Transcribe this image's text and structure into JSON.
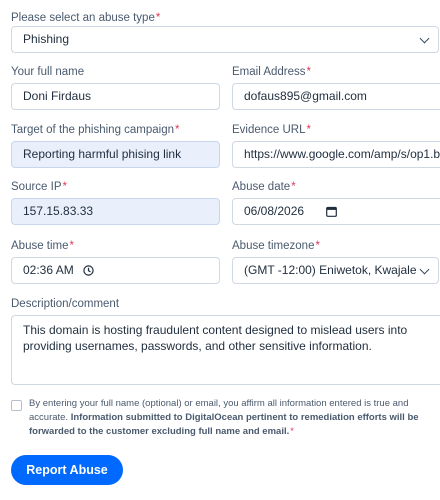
{
  "abuse_type": {
    "label": "Please select an abuse type",
    "value": "Phishing"
  },
  "full_name": {
    "label": "Your full name",
    "value": "Doni Firdaus"
  },
  "email": {
    "label": "Email Address",
    "value": "dofaus895@gmail.com"
  },
  "target": {
    "label": "Target of the phishing campaign",
    "value": "Reporting harmful phising link"
  },
  "evidence_url": {
    "label": "Evidence URL",
    "value": "https://www.google.com/amp/s/op1.bu"
  },
  "source_ip": {
    "label": "Source IP",
    "value": "157.15.83.33"
  },
  "abuse_date": {
    "label": "Abuse date",
    "value": "06/08/2026"
  },
  "abuse_time": {
    "label": "Abuse time",
    "value": "02:36 AM"
  },
  "timezone": {
    "label": "Abuse timezone",
    "value": "(GMT -12:00) Eniwetok, Kwajale"
  },
  "description": {
    "label": "Description/comment",
    "value": "This domain is hosting fraudulent content designed to mislead users into providing usernames, passwords, and other sensitive information."
  },
  "consent": {
    "text": "By entering your full name (optional) or email, you affirm all information entered is true and accurate.",
    "bold": "Information submitted to DigitalOcean pertinent to remediation efforts will be forwarded to the customer excluding full name and email.",
    "required_mark": "*"
  },
  "submit_label": "Report Abuse",
  "required_mark": "*",
  "colors": {
    "accent": "#0069ff",
    "required": "#e0395a",
    "filled_bg": "#e9f0fc"
  }
}
